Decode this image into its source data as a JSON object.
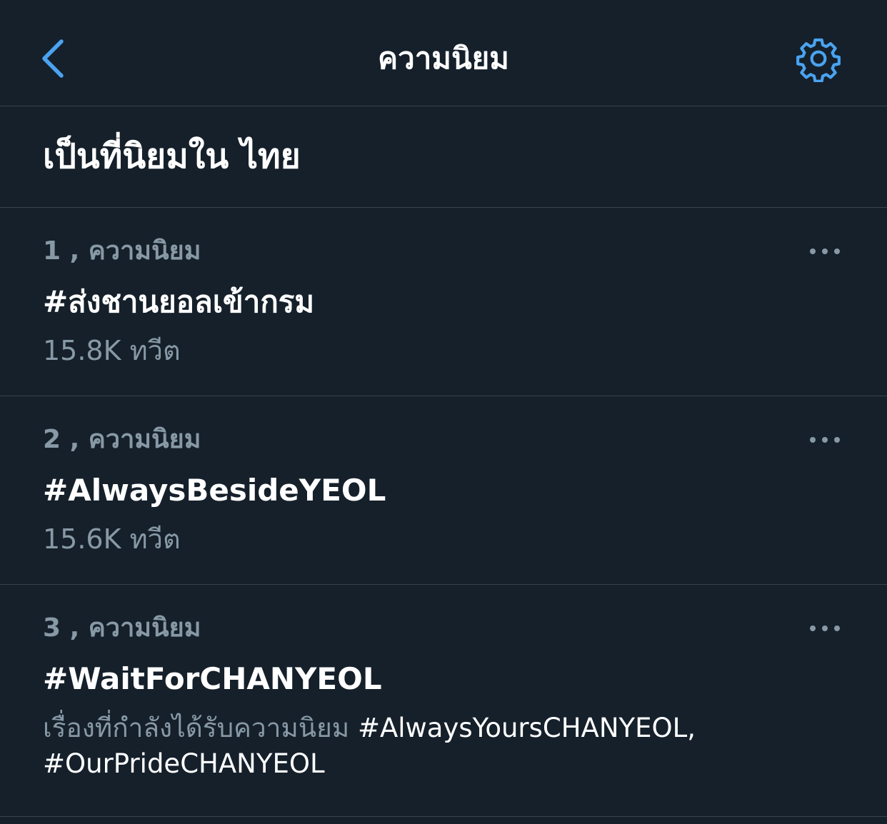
{
  "nav": {
    "title": "ความนิยม",
    "back_icon": "chevron-left-icon",
    "settings_icon": "gear-icon"
  },
  "section": {
    "title": "เป็นที่นิยมใน ไทย"
  },
  "trends": [
    {
      "context": "1 , ความนิยม",
      "name": "#ส่งชานยอลเข้ากรม",
      "meta": "15.8K ทวีต"
    },
    {
      "context": "2 , ความนิยม",
      "name": "#AlwaysBesideYEOL",
      "meta": "15.6K ทวีต"
    },
    {
      "context": "3 , ความนิยม",
      "name": "#WaitForCHANYEOL",
      "related_prefix": "เรื่องที่กำลังได้รับความนิยม ",
      "related_tags": "#AlwaysYoursCHANYEOL, #OurPrideCHANYEOL"
    }
  ],
  "colors": {
    "background": "#15202b",
    "accent": "#1d9bf0",
    "secondary_text": "#8899a6",
    "divider": "#38444d"
  }
}
